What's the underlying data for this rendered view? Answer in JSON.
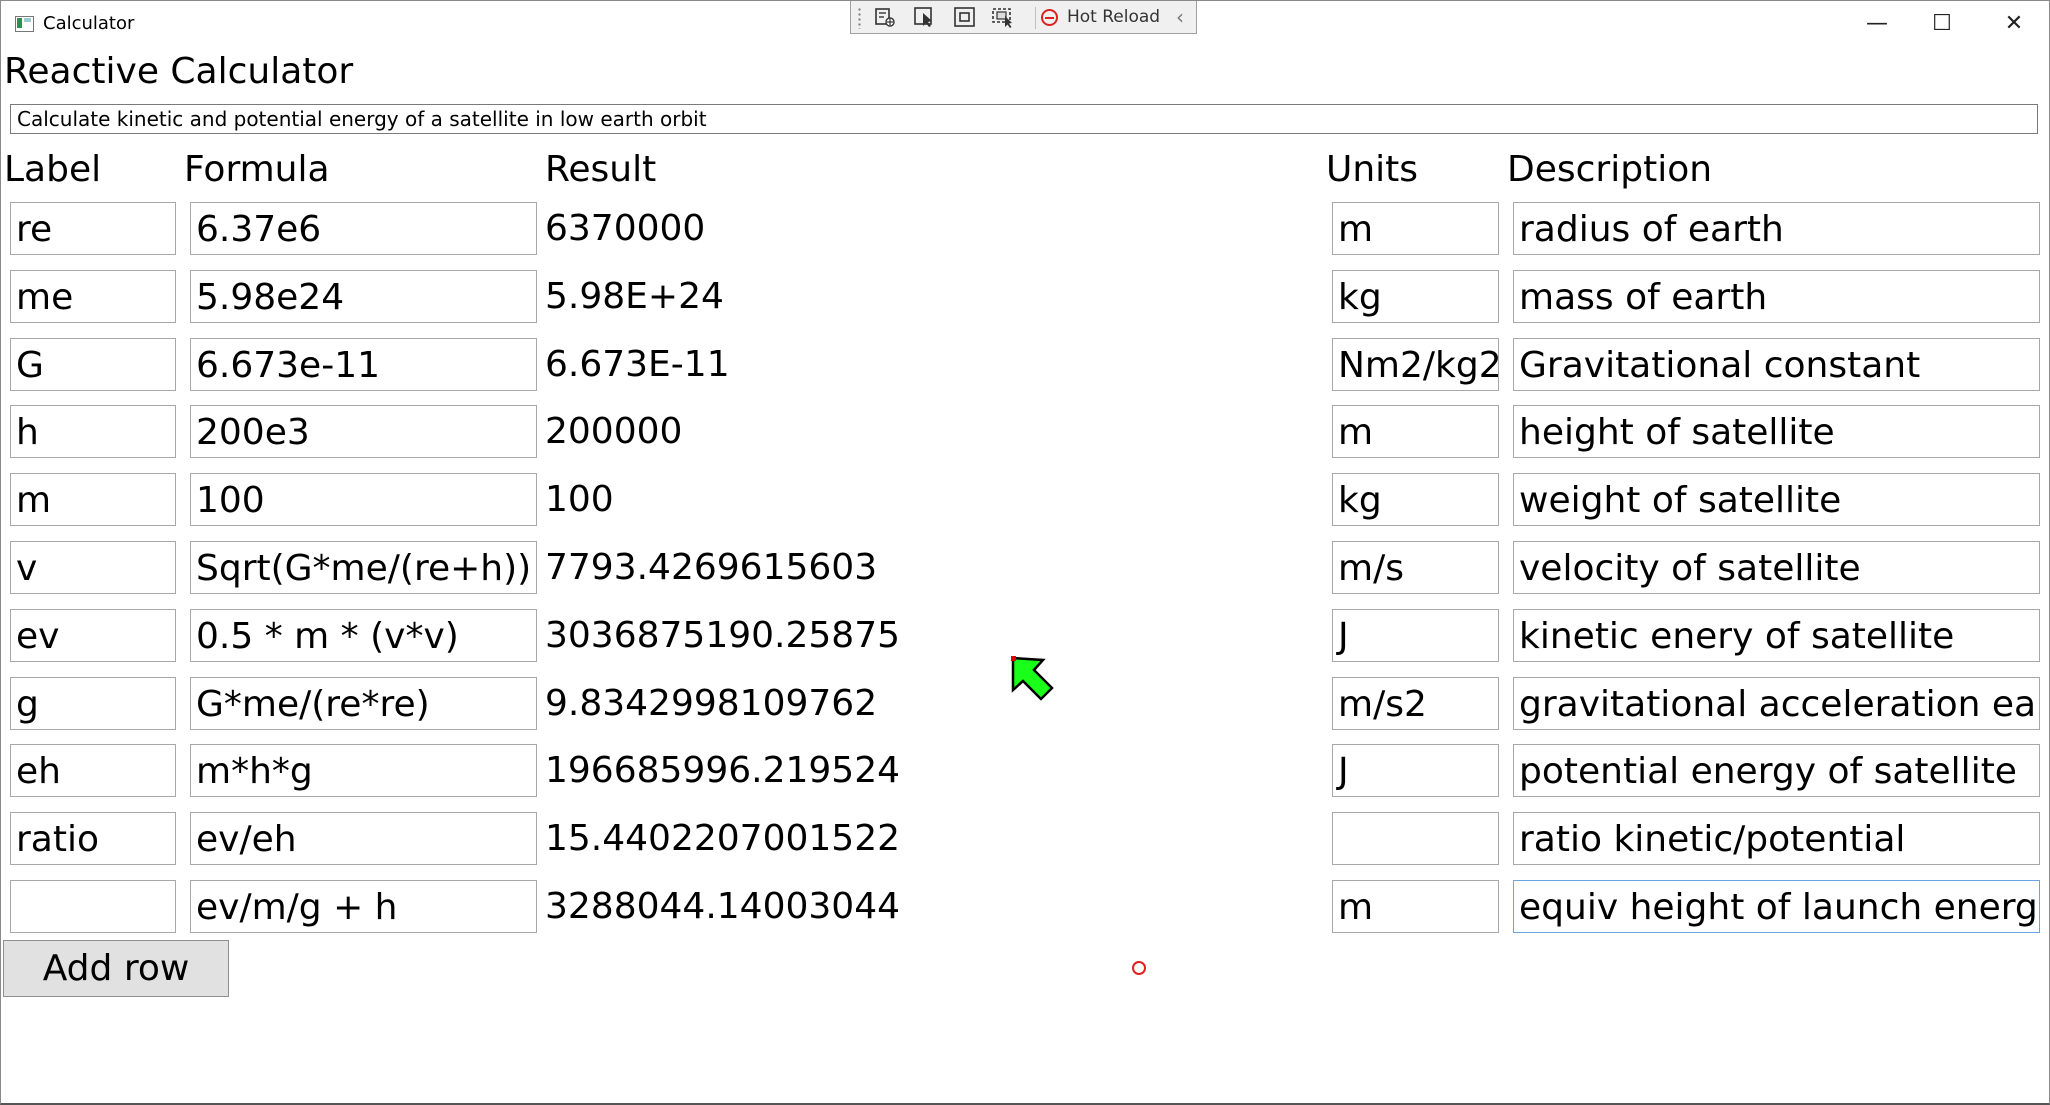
{
  "window": {
    "title": "Calculator",
    "minimize_glyph": "—",
    "maximize_glyph": "☐",
    "close_glyph": "✕"
  },
  "devtools": {
    "hot_reload_label": "Hot Reload",
    "collapse_glyph": "‹"
  },
  "app": {
    "heading": "Reactive Calculator",
    "description": "Calculate kinetic and potential energy of a satellite in low earth orbit",
    "add_row_label": "Add row"
  },
  "columns": {
    "label": "Label",
    "formula": "Formula",
    "result": "Result",
    "units": "Units",
    "description": "Description"
  },
  "rows": [
    {
      "label": "re",
      "formula": "6.37e6",
      "result": "6370000",
      "units": "m",
      "description": "radius of earth"
    },
    {
      "label": "me",
      "formula": "5.98e24",
      "result": "5.98E+24",
      "units": "kg",
      "description": "mass of earth"
    },
    {
      "label": "G",
      "formula": "6.673e-11",
      "result": "6.673E-11",
      "units": "Nm2/kg2",
      "description": "Gravitational constant"
    },
    {
      "label": "h",
      "formula": "200e3",
      "result": "200000",
      "units": "m",
      "description": "height of satellite"
    },
    {
      "label": "m",
      "formula": "100",
      "result": "100",
      "units": "kg",
      "description": "weight of satellite"
    },
    {
      "label": "v",
      "formula": "Sqrt(G*me/(re+h))",
      "result": "7793.4269615603",
      "units": "m/s",
      "description": "velocity of satellite"
    },
    {
      "label": "ev",
      "formula": "0.5 * m * (v*v)",
      "result": "3036875190.25875",
      "units": "J",
      "description": "kinetic enery of satellite"
    },
    {
      "label": "g",
      "formula": "G*me/(re*re)",
      "result": "9.8342998109762",
      "units": "m/s2",
      "description": "gravitational acceleration earth"
    },
    {
      "label": "eh",
      "formula": "m*h*g",
      "result": "196685996.219524",
      "units": "J",
      "description": "potential energy of satellite"
    },
    {
      "label": "ratio",
      "formula": "ev/eh",
      "result": "15.4402207001522",
      "units": "",
      "description": "ratio kinetic/potential"
    },
    {
      "label": "",
      "formula": "ev/m/g + h",
      "result": "3288044.14003044",
      "units": "m",
      "description": "equiv height of launch energy"
    }
  ]
}
